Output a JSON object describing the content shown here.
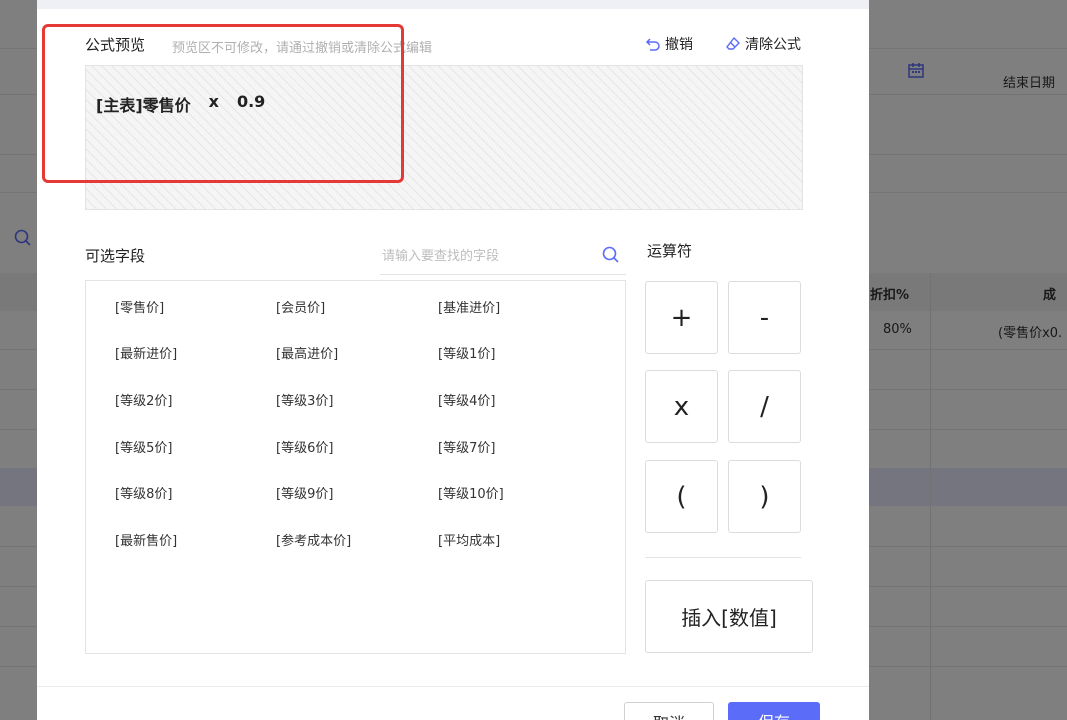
{
  "background": {
    "end_date_label": "结束日期",
    "discount_header": "折扣%",
    "col_header_partial": "成",
    "discount_value": "80%",
    "formula_value_partial": "(零售价x0."
  },
  "dialog": {
    "preview": {
      "title": "公式预览",
      "hint": "预览区不可修改，请通过撤销或清除公式编辑",
      "undo_label": "撤销",
      "clear_label": "清除公式",
      "formula": {
        "field": "[主表]零售价",
        "operator": "x",
        "value": "0.9"
      }
    },
    "fields": {
      "title": "可选字段",
      "search_placeholder": "请输入要查找的字段",
      "items": [
        "[零售价]",
        "[会员价]",
        "[基准进价]",
        "[最新进价]",
        "[最高进价]",
        "[等级1价]",
        "[等级2价]",
        "[等级3价]",
        "[等级4价]",
        "[等级5价]",
        "[等级6价]",
        "[等级7价]",
        "[等级8价]",
        "[等级9价]",
        "[等级10价]",
        "[最新售价]",
        "[参考成本价]",
        "[平均成本]"
      ]
    },
    "operators": {
      "title": "运算符",
      "plus": "+",
      "minus": "-",
      "multiply": "x",
      "divide": "/",
      "open_paren": "(",
      "close_paren": ")",
      "insert_value": "插入[数值]"
    },
    "footer": {
      "cancel_label": "取消",
      "save_label": "保存"
    }
  },
  "colors": {
    "primary": "#5b6cf9",
    "highlight_box": "#e53935",
    "overlay": "rgba(0,0,0,0.5)"
  }
}
